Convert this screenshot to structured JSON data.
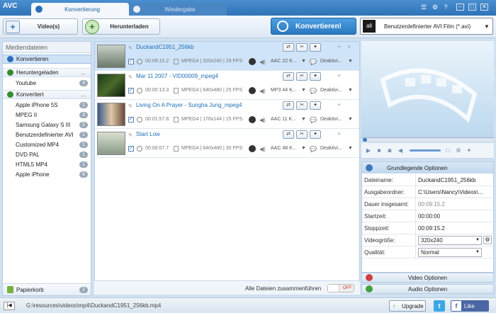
{
  "app": {
    "logo": "AVC"
  },
  "tabs": [
    {
      "label": "Konvertierung"
    },
    {
      "label": "Wiedergabe"
    }
  ],
  "window": {
    "min": "–",
    "max": "□",
    "close": "✕"
  },
  "toolbar": {
    "add_video_label": "Video(s)",
    "download_label": "Herunterladen",
    "convert_label": "Konvertieren!",
    "format_icon_text": "all",
    "format_label": "Benutzerdefinierter AVI Film (*.avi)"
  },
  "sidebar": {
    "header": "Mediendateien",
    "groups": {
      "converting": {
        "label": "Konvertieren"
      },
      "downloaded": {
        "label": "Heruntergeladen"
      },
      "converted": {
        "label": "Konvertiert"
      }
    },
    "downloaded_items": [
      {
        "label": "Youtube",
        "count": "3"
      }
    ],
    "converted_items": [
      {
        "label": "Apple iPhone 5S",
        "count": "1"
      },
      {
        "label": "MPEG II",
        "count": "3"
      },
      {
        "label": "Samsung Galaxy S III",
        "count": "2"
      },
      {
        "label": "Benutzerdefinierter AVI",
        "count": "1"
      },
      {
        "label": "Customized MP4",
        "count": "1"
      },
      {
        "label": "DVD PAL",
        "count": "1"
      },
      {
        "label": "HTML5 MP4",
        "count": "1"
      },
      {
        "label": "Apple iPhone",
        "count": "6"
      }
    ],
    "trash": {
      "label": "Papierkorb",
      "count": "2"
    }
  },
  "items": [
    {
      "title": "DuckandC1951_256kb",
      "duration": "00:09:15.2",
      "meta": "MPEG4 | 320x240 | 29 FPS",
      "audio": "AAC 22 K...",
      "subtitle": "Deaktivi..."
    },
    {
      "title": "Mar 11 2007 - VID00009_mpeg4",
      "duration": "00:00:13.3",
      "meta": "MPEG4 | 640x480 | 25 FPS",
      "audio": "MP3 44 K...",
      "subtitle": "Deaktivi..."
    },
    {
      "title": "Living On A Prayer - Sungha Jung_mpeg4",
      "duration": "00:01:57.8",
      "meta": "MPEG4 | 176x144 | 15 FPS",
      "audio": "AAC 11 K...",
      "subtitle": "Deaktivi..."
    },
    {
      "title": "Start Low",
      "duration": "00:00:07.7",
      "meta": "MPEG4 | 640x480 | 30 FPS",
      "audio": "AAC 48 K...",
      "subtitle": "Deaktivi..."
    }
  ],
  "merge": {
    "label": "Alle Dateien zusammenführen",
    "toggle": "OFF"
  },
  "options": {
    "header": "Grundlegende Optionen",
    "rows": {
      "filename": {
        "label": "Dateiname:",
        "value": "DuckandC1951_256kb"
      },
      "output": {
        "label": "Ausgabeordner:",
        "value": "C:\\Users\\Nancy\\Videos\\..."
      },
      "duration": {
        "label": "Dauer insgesamt:",
        "value": "00:09:15.2"
      },
      "start": {
        "label": "Startzeit:",
        "value": "00:00:00"
      },
      "stop": {
        "label": "Stoppzeit:",
        "value": "00:09:15.2"
      },
      "size": {
        "label": "Videogröße:",
        "value": "320x240"
      },
      "quality": {
        "label": "Qualität:",
        "value": "Normal"
      }
    },
    "video_options": "Video Optionen",
    "audio_options": "Audio Optionen"
  },
  "status": {
    "path": "G:\\resources\\videos\\mp4\\DuckandC1951_256kb.mp4",
    "upgrade": "Upgrade",
    "twitter": "t",
    "like": "Like"
  }
}
